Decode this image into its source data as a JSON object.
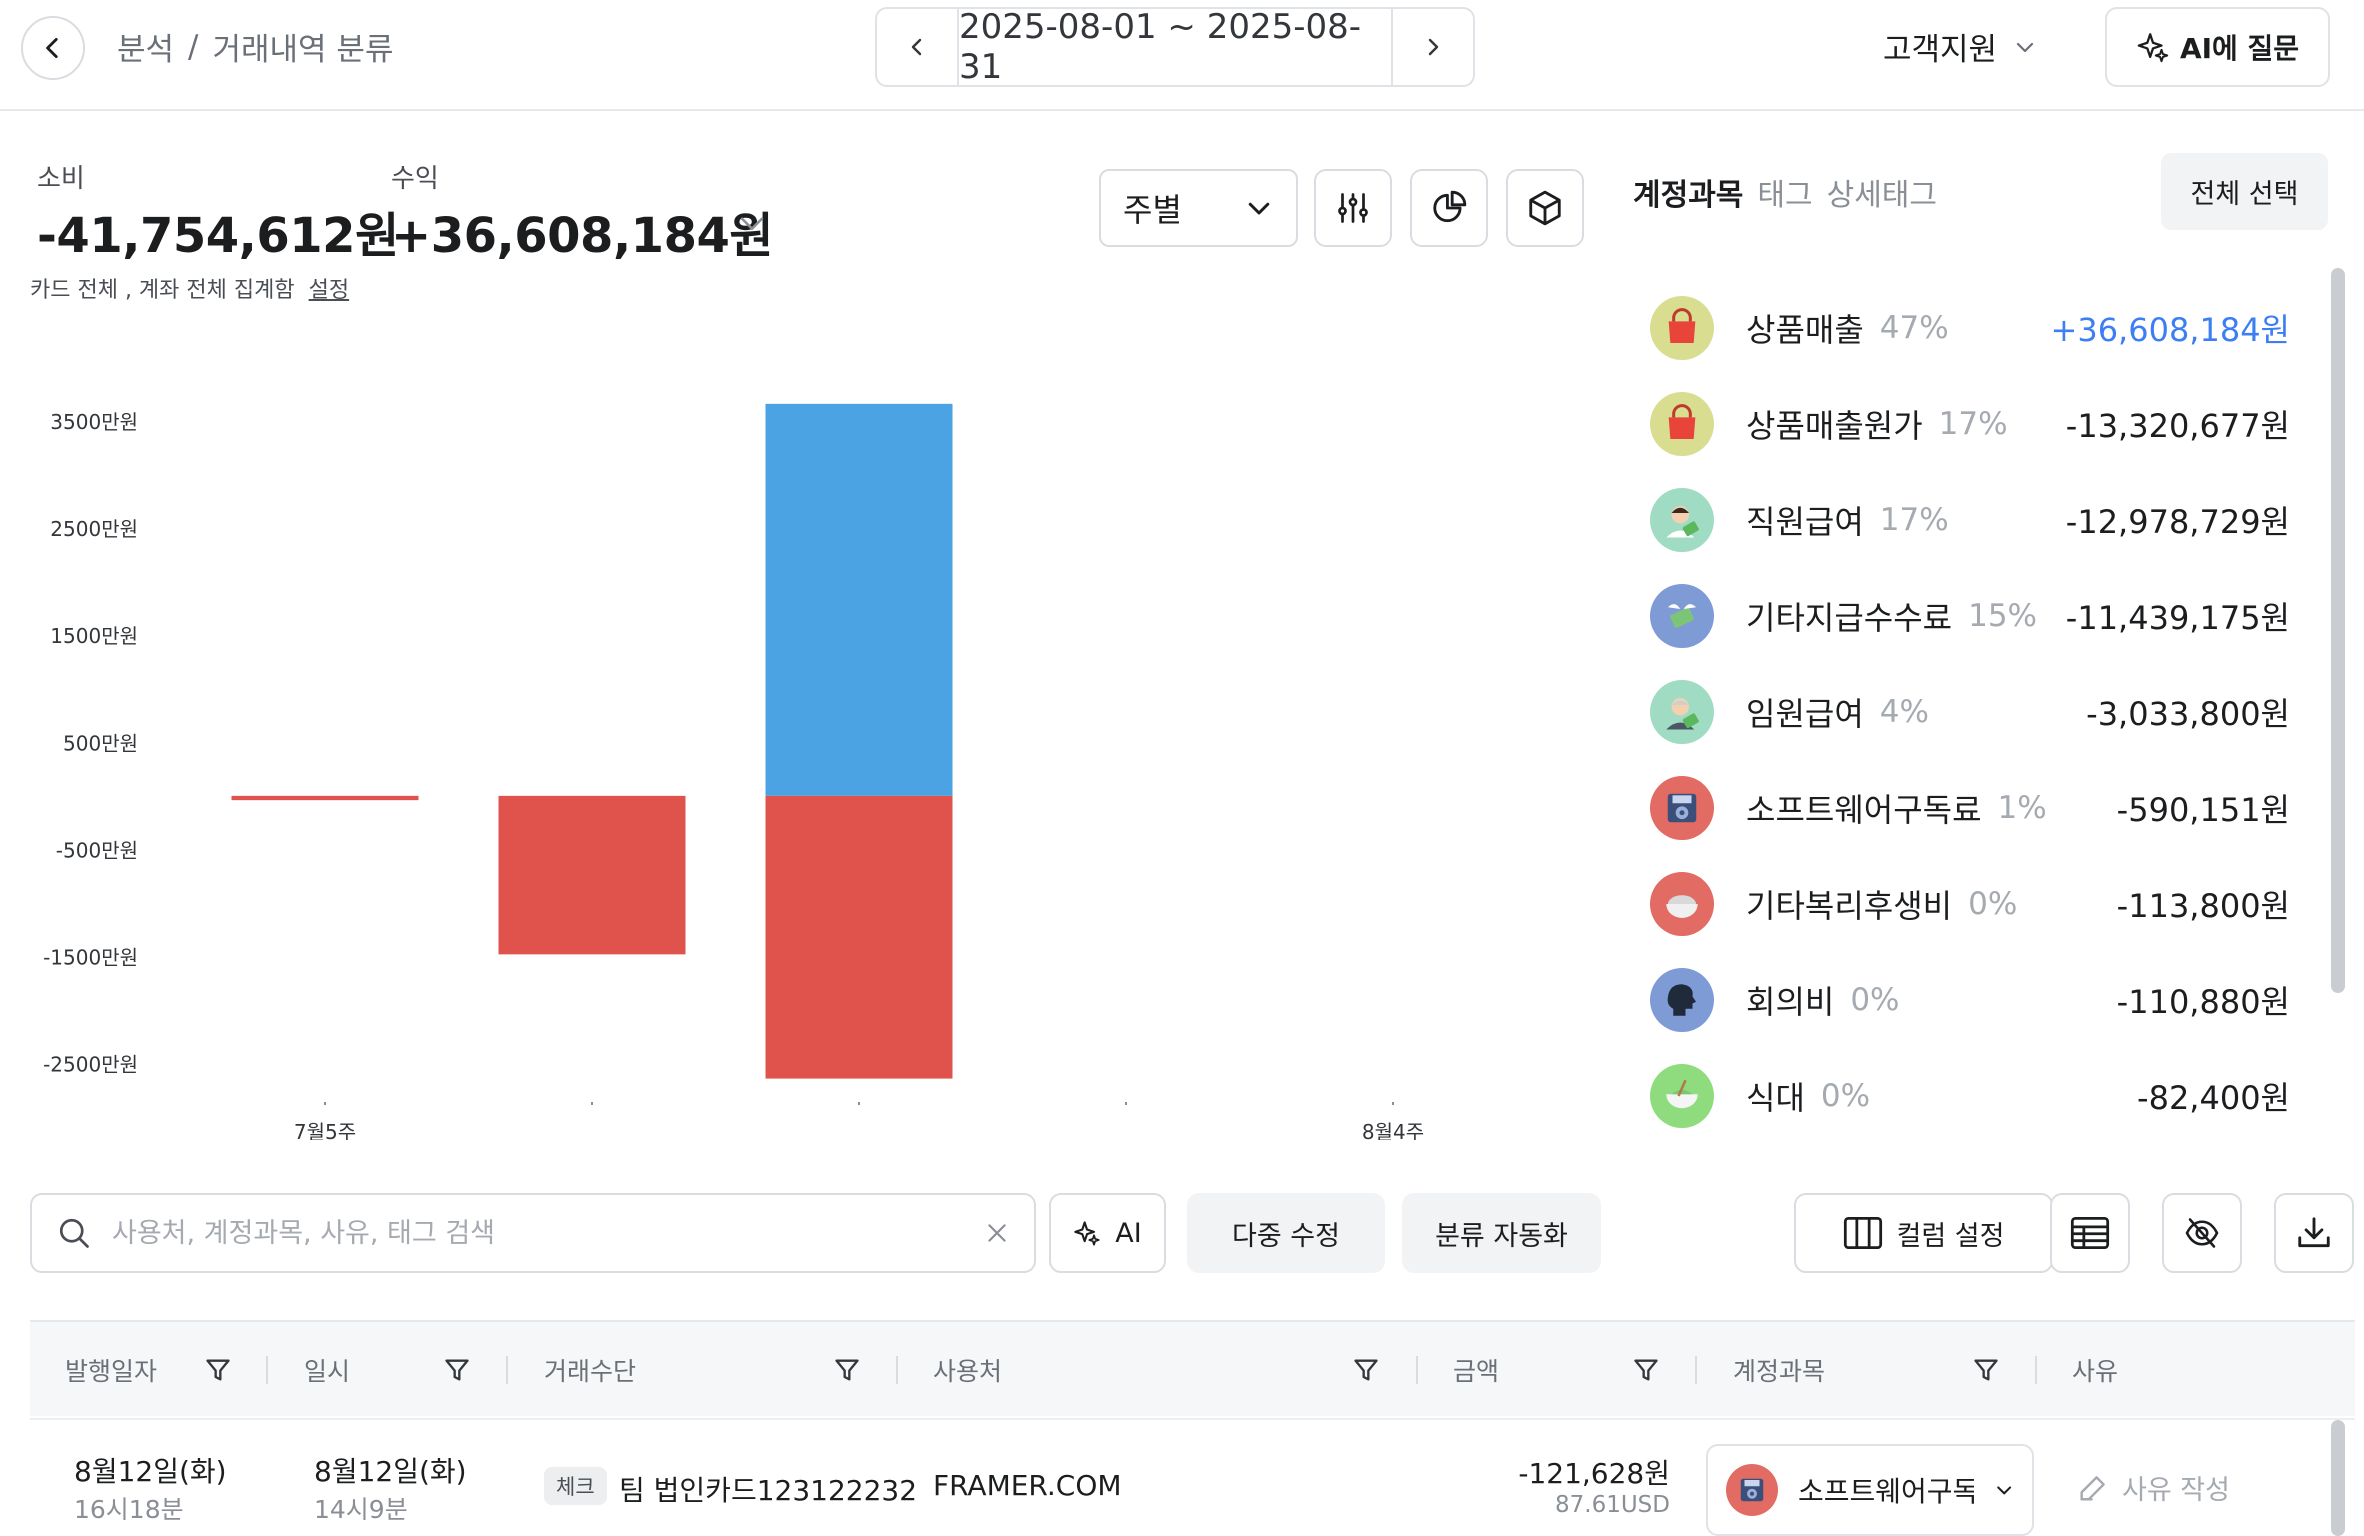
{
  "header": {
    "breadcrumb": [
      "분석",
      "/",
      "거래내역 분류"
    ],
    "date_range": "2025-08-01 ~ 2025-08-31",
    "support_label": "고객지원",
    "ai_button_label": "AI에 질문"
  },
  "summary": {
    "spend_label": "소비",
    "spend_value": "-41,754,612원",
    "income_label": "수익",
    "income_value": "+36,608,184원",
    "note": "카드 전체 , 계좌 전체 집계함",
    "note_link": "설정",
    "period_option": "주별"
  },
  "colors": {
    "income": "#4ba3e3",
    "expense": "#e0534c",
    "positive_text": "#3d7ef5"
  },
  "chart_data": {
    "type": "bar",
    "stacked": true,
    "categories": [
      "7월5주",
      "",
      "",
      "",
      "8월4주"
    ],
    "y_tick_labels": [
      "3500만원",
      "2500만원",
      "1500만원",
      "500만원",
      "-500만원",
      "-1500만원",
      "-2500만원"
    ],
    "y_ticks": [
      3500,
      2500,
      1500,
      500,
      -500,
      -1500,
      -2500
    ],
    "ylim": [
      -2700,
      3650
    ],
    "unit": "만원",
    "series": [
      {
        "values": [
          0,
          0,
          3660.8,
          0,
          0
        ],
        "color": "#4ba3e3"
      },
      {
        "values": [
          -40,
          -1480,
          -2640,
          0,
          0
        ],
        "color": "#e0534c"
      }
    ]
  },
  "category_panel": {
    "tabs": [
      {
        "label": "계정과목",
        "active": true
      },
      {
        "label": "태그",
        "active": false
      },
      {
        "label": "상세태그",
        "active": false
      }
    ],
    "select_all_label": "전체 선택",
    "items": [
      {
        "name": "상품매출",
        "pct": "47%",
        "amount": "+36,608,184원",
        "positive": true,
        "icon": "shopping-bag-icon",
        "bg": "#d9dd8f"
      },
      {
        "name": "상품매출원가",
        "pct": "17%",
        "amount": "-13,320,677원",
        "positive": false,
        "icon": "shopping-bag-icon",
        "bg": "#d9dd8f"
      },
      {
        "name": "직원급여",
        "pct": "17%",
        "amount": "-12,978,729원",
        "positive": false,
        "icon": "employee-pay-icon",
        "bg": "#9fdcc3"
      },
      {
        "name": "기타지급수수료",
        "pct": "15%",
        "amount": "-11,439,175원",
        "positive": false,
        "icon": "money-wings-icon",
        "bg": "#7f9bd6"
      },
      {
        "name": "임원급여",
        "pct": "4%",
        "amount": "-3,033,800원",
        "positive": false,
        "icon": "executive-pay-icon",
        "bg": "#9fdcc3"
      },
      {
        "name": "소프트웨어구독료",
        "pct": "1%",
        "amount": "-590,151원",
        "positive": false,
        "icon": "floppy-disk-icon",
        "bg": "#e26b63"
      },
      {
        "name": "기타복리후생비",
        "pct": "0%",
        "amount": "-113,800원",
        "positive": false,
        "icon": "rice-bowl-icon",
        "bg": "#e26b63"
      },
      {
        "name": "회의비",
        "pct": "0%",
        "amount": "-110,880원",
        "positive": false,
        "icon": "speaking-head-icon",
        "bg": "#7f9bd6"
      },
      {
        "name": "식대",
        "pct": "0%",
        "amount": "-82,400원",
        "positive": false,
        "icon": "food-bowl-icon",
        "bg": "#8fdc7f"
      }
    ]
  },
  "toolbar": {
    "search_placeholder": "사용처, 계정과목, 사유, 태그 검색",
    "ai_label": "AI",
    "bulk_edit_label": "다중 수정",
    "auto_classify_label": "분류 자동화",
    "column_settings_label": "컬럼 설정"
  },
  "table": {
    "columns": [
      "발행일자",
      "일시",
      "거래수단",
      "사용처",
      "금액",
      "계정과목",
      "사유"
    ],
    "rows": [
      {
        "issue_date": "8월12일(화)",
        "issue_time": "16시18분",
        "date": "8월12일(화)",
        "time": "14시9분",
        "method_chip": "체크",
        "method": "팀 법인카드123122232",
        "merchant": "FRAMER.COM",
        "amount": "-121,628원",
        "amount_foreign": "87.61USD",
        "account": "소프트웨어구독료",
        "reason_placeholder": "사유 작성"
      }
    ]
  }
}
